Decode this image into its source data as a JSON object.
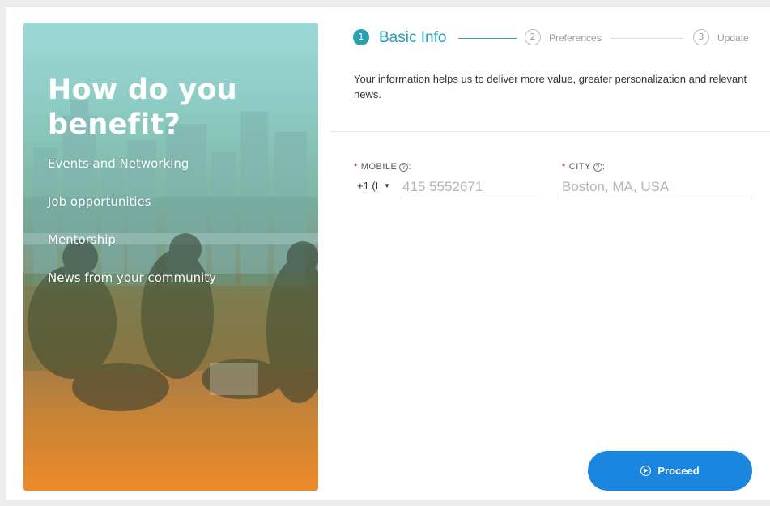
{
  "hero": {
    "title": "How do you benefit?",
    "benefits": [
      "Events and Networking",
      "Job opportunities",
      "Mentorship",
      "News from your community"
    ]
  },
  "stepper": {
    "steps": [
      {
        "number": "1",
        "label": "Basic Info",
        "state": "active"
      },
      {
        "number": "2",
        "label": "Preferences",
        "state": "inactive"
      },
      {
        "number": "3",
        "label": "Update",
        "state": "inactive"
      }
    ]
  },
  "intro_text": "Your information helps us to deliver more value, greater personalization and relevant news.",
  "form": {
    "mobile": {
      "label": "MOBILE",
      "required_mark": "*",
      "help_glyph": "?",
      "colon": ":",
      "country_code": "+1 (L",
      "placeholder": "415 5552671",
      "value": ""
    },
    "city": {
      "label": "CITY",
      "required_mark": "*",
      "help_glyph": "?",
      "colon": ":",
      "placeholder": "Boston, MA, USA",
      "value": ""
    }
  },
  "proceed_button": {
    "label": "Proceed",
    "icon": "arrow-circle-icon"
  },
  "colors": {
    "accent": "#2a9fb0",
    "button": "#1a86e0",
    "required": "#d0021b"
  }
}
